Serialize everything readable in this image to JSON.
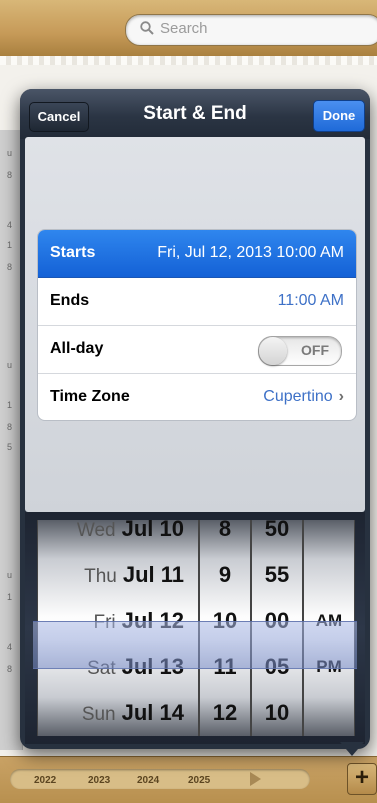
{
  "search": {
    "placeholder": "Search"
  },
  "left_strip": {
    "numbers": [
      "u",
      "8",
      "4",
      "1",
      "8",
      "u",
      "1",
      "8",
      "5",
      "u",
      "1",
      "4",
      "8"
    ]
  },
  "timeline": {
    "years": [
      "2022",
      "2023",
      "2024",
      "2025"
    ],
    "add_label": "+"
  },
  "popover": {
    "title": "Start & End",
    "cancel_label": "Cancel",
    "done_label": "Done",
    "rows": [
      {
        "label": "Starts",
        "value": "Fri, Jul 12, 2013  10:00 AM",
        "selected": true
      },
      {
        "label": "Ends",
        "value": "11:00 AM"
      },
      {
        "label": "All-day",
        "toggle_text": "OFF"
      },
      {
        "label": "Time Zone",
        "value": "Cupertino",
        "chevron": "›"
      }
    ],
    "picker": {
      "days": [
        {
          "weekday": "Wed",
          "date": "Jul 10"
        },
        {
          "weekday": "Thu",
          "date": "Jul 11"
        },
        {
          "weekday": "Fri",
          "date": "Jul 12"
        },
        {
          "weekday": "Sat",
          "date": "Jul 13"
        },
        {
          "weekday": "Sun",
          "date": "Jul 14"
        }
      ],
      "hours": [
        "8",
        "9",
        "10",
        "11",
        "12"
      ],
      "minutes": [
        "50",
        "55",
        "00",
        "05",
        "10"
      ],
      "ampm": [
        "",
        "",
        "AM",
        "PM",
        ""
      ]
    }
  },
  "colors": {
    "accent": "#1f6ad8",
    "value_blue": "#3e71c7",
    "popover_dark": "#27313f"
  }
}
